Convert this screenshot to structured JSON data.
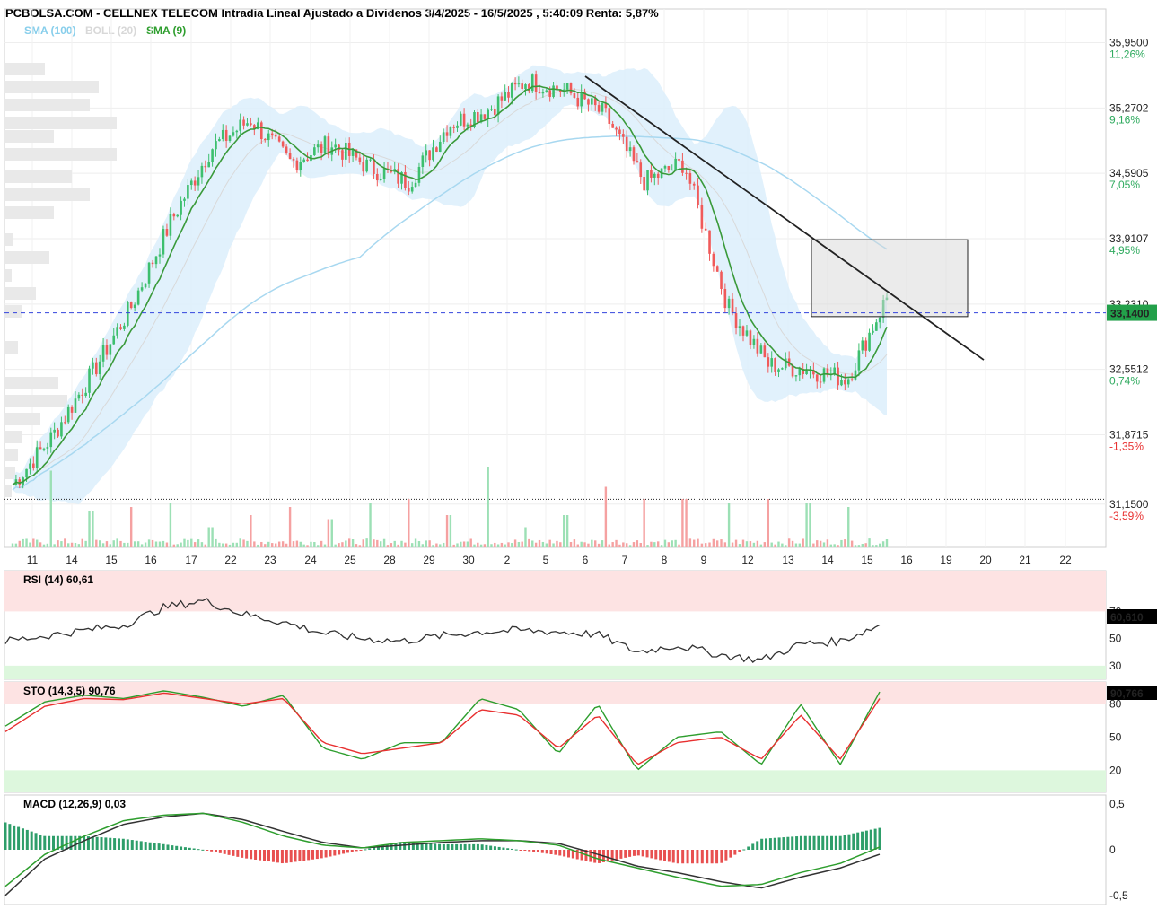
{
  "header": {
    "title": "PCBOLSA.COM - CELLNEX TELECOM Intradia Lineal Ajustado a Dividenos 3/4/2025 - 16/5/2025 , 5:40:09 Renta: 5,87%",
    "legend": [
      {
        "label": "SMA (100)",
        "color": "#87CEEB"
      },
      {
        "label": "BOLL (20)",
        "color": "#D8D8D8"
      },
      {
        "label": "SMA (9)",
        "color": "#2E9E2E"
      }
    ]
  },
  "colors": {
    "up": "#3DBF6E",
    "down": "#F05A5A",
    "boll_fill": "#DCEEFB",
    "sma100": "#A8D8F0",
    "sma9": "#3A9A3A",
    "ref_line": "#3344DD",
    "rsi_line": "#333333",
    "stoch_k": "#2E9E2E",
    "stoch_d": "#E83030",
    "overbought_zone": "#FDE3E3",
    "oversold_zone": "#DDF7DD",
    "last_price_box": "#22A04A"
  },
  "chart_data": [
    {
      "type": "candlestick",
      "title": "PCBOLSA.COM - CELLNEX TELECOM Intradia Lineal Ajustado a Dividenos 3/4/2025 - 16/5/2025 , 5:40:09 Renta: 5,87%",
      "x_ticks": [
        "11",
        "14",
        "15",
        "16",
        "17",
        "22",
        "23",
        "24",
        "25",
        "28",
        "29",
        "30",
        "2",
        "5",
        "6",
        "7",
        "8",
        "9",
        "12",
        "13",
        "14",
        "15",
        "16",
        "19",
        "20",
        "21",
        "22"
      ],
      "y_ticks": [
        "35,9500",
        "35,2702",
        "34,5905",
        "33,9107",
        "33,2310",
        "32,5512",
        "31,8715",
        "31,1500"
      ],
      "pct_ticks": [
        "11,26%",
        "9,16%",
        "7,05%",
        "4,95%",
        "",
        "0,74%",
        "-1,35%",
        "-3,59%"
      ],
      "ylim": [
        30.7,
        36.3
      ],
      "last_price": "33,1400",
      "session_closes": [
        31.35,
        31.85,
        32.5,
        33.2,
        34.1,
        34.85,
        35.15,
        34.7,
        34.9,
        34.65,
        34.5,
        35.1,
        35.25,
        35.55,
        35.45,
        35.2,
        34.5,
        34.7,
        33.2,
        32.6,
        32.55,
        32.45,
        33.3
      ],
      "volume_peaks": [
        0.05,
        0.95,
        0.45,
        0.5,
        0.55,
        0.25,
        0.4,
        0.5,
        0.35,
        0.55,
        0.6,
        0.4,
        1.0,
        0.25,
        0.4,
        0.75,
        0.6,
        0.6,
        0.55,
        0.6,
        0.55,
        0.5,
        0.1
      ],
      "trendline": {
        "from": {
          "session": "6",
          "price": 35.6
        },
        "to": {
          "session": "19",
          "price": 32.65
        }
      },
      "rectangle": {
        "price_high": 33.9,
        "price_low": 33.1,
        "from_session": "13",
        "to_session": "19"
      },
      "reference_level": 31.2
    },
    {
      "type": "line",
      "title": "RSI (14)",
      "last_value_label": "60,61",
      "last_value_box": "60,610",
      "y_ticks": [
        "70",
        "50",
        "30"
      ],
      "zones": {
        "overbought": 70,
        "oversold": 30
      },
      "session_values": [
        48,
        52,
        56,
        60,
        73,
        78,
        68,
        62,
        54,
        50,
        48,
        52,
        55,
        56,
        55,
        53,
        40,
        45,
        38,
        34,
        46,
        48,
        60
      ]
    },
    {
      "type": "line",
      "title": "STO (14,3,5)",
      "last_value_label": "90,76",
      "last_value_box": "90,766",
      "y_ticks": [
        "80",
        "50",
        "20"
      ],
      "zones": {
        "overbought": 80,
        "oversold": 20
      },
      "k_values": [
        60,
        82,
        88,
        85,
        92,
        86,
        78,
        88,
        40,
        30,
        45,
        45,
        85,
        75,
        35,
        80,
        20,
        50,
        55,
        25,
        80,
        25,
        91
      ],
      "d_values": [
        55,
        78,
        85,
        84,
        90,
        85,
        80,
        85,
        45,
        35,
        40,
        45,
        75,
        70,
        40,
        70,
        25,
        45,
        50,
        30,
        70,
        30,
        85
      ]
    },
    {
      "type": "line",
      "title": "MACD (12,26,9)",
      "last_value_label": "0,03",
      "y_ticks": [
        "0,5",
        "0",
        "-0,5"
      ],
      "macd_values": [
        -0.4,
        -0.05,
        0.15,
        0.32,
        0.38,
        0.4,
        0.3,
        0.15,
        0.05,
        0.02,
        0.08,
        0.1,
        0.12,
        0.1,
        0.05,
        -0.1,
        -0.2,
        -0.3,
        -0.4,
        -0.38,
        -0.25,
        -0.15,
        0.03
      ],
      "signal_values": [
        -0.5,
        -0.1,
        0.1,
        0.28,
        0.36,
        0.4,
        0.33,
        0.2,
        0.08,
        0.02,
        0.05,
        0.08,
        0.1,
        0.1,
        0.07,
        -0.05,
        -0.18,
        -0.25,
        -0.35,
        -0.42,
        -0.3,
        -0.2,
        -0.05
      ]
    }
  ]
}
